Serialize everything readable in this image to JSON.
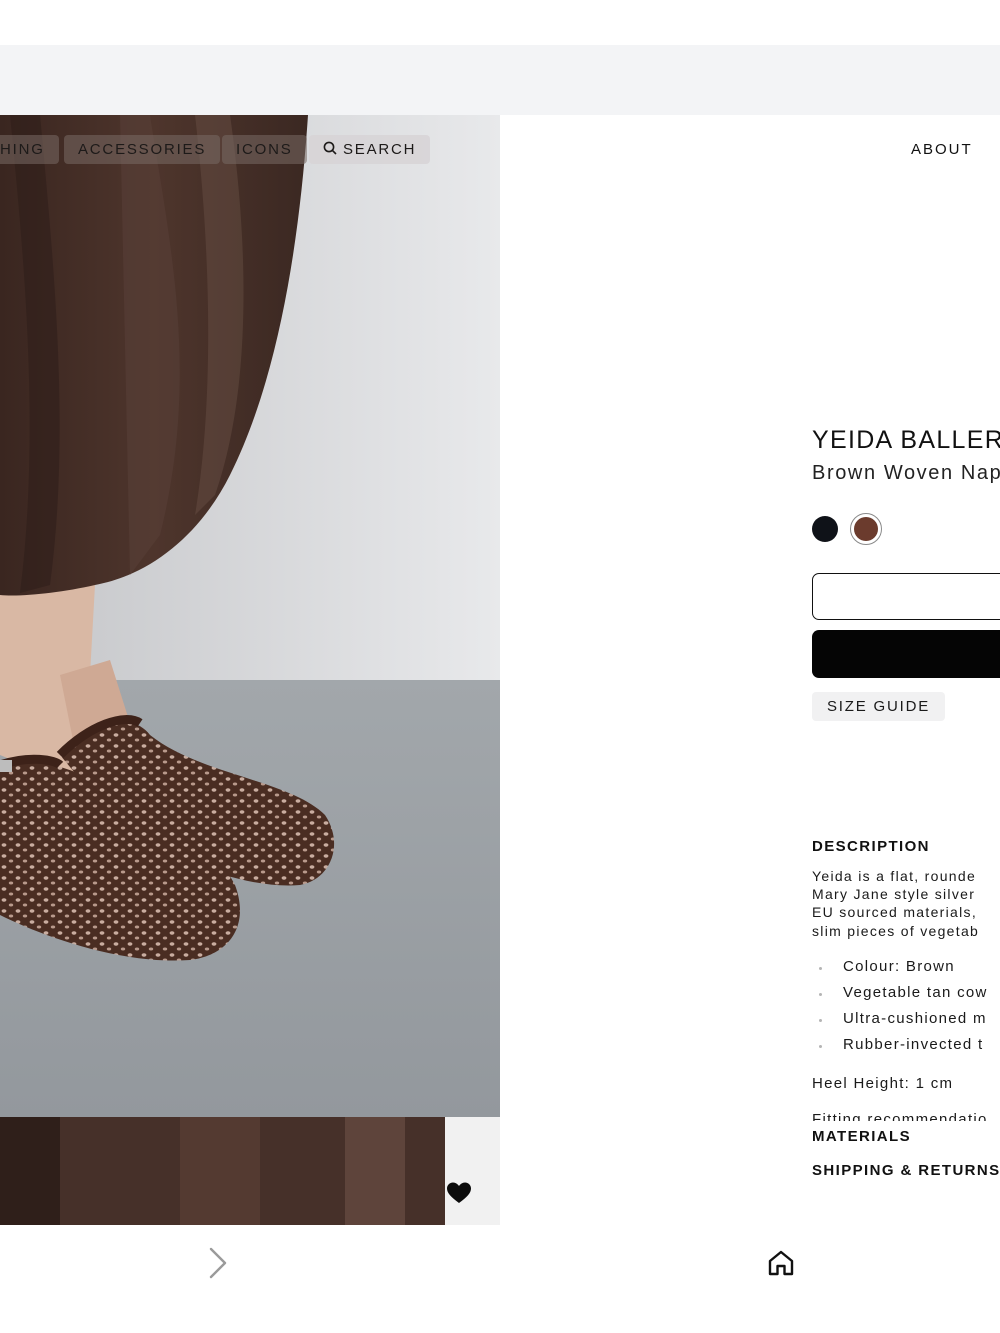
{
  "nav": {
    "items": [
      {
        "label": "HING"
      },
      {
        "label": "ACCESSORIES"
      },
      {
        "label": "ICONS"
      },
      {
        "label": "SEARCH",
        "icon": "search-icon"
      }
    ],
    "about_label": "ABOUT"
  },
  "product": {
    "title": "YEIDA BALLER",
    "subtitle": "Brown Woven Nap",
    "colour_swatches": [
      {
        "name": "black",
        "color": "#0f1218",
        "selected": false
      },
      {
        "name": "brown",
        "color": "#6b3b2d",
        "selected": true
      }
    ],
    "size_guide_label": "SIZE GUIDE"
  },
  "description": {
    "heading": "DESCRIPTION",
    "lines": [
      "Yeida is a flat, rounde",
      "Mary Jane style silver",
      "EU sourced materials,",
      "slim pieces of vegetab"
    ],
    "specs": [
      "Colour: Brown",
      "Vegetable tan cow",
      "Ultra-cushioned m",
      "Rubber-invected t"
    ],
    "heel_height": "Heel Height: 1 cm",
    "fitting": "Fitting recommendatio"
  },
  "accordions": {
    "materials": "MATERIALS",
    "shipping": "SHIPPING & RETURNS"
  },
  "toolbar": {
    "forward_icon": "chevron-right-icon",
    "home_icon": "home-icon"
  },
  "colors": {
    "accent_black": "#050505",
    "ui_gray": "#f3f4f6"
  }
}
